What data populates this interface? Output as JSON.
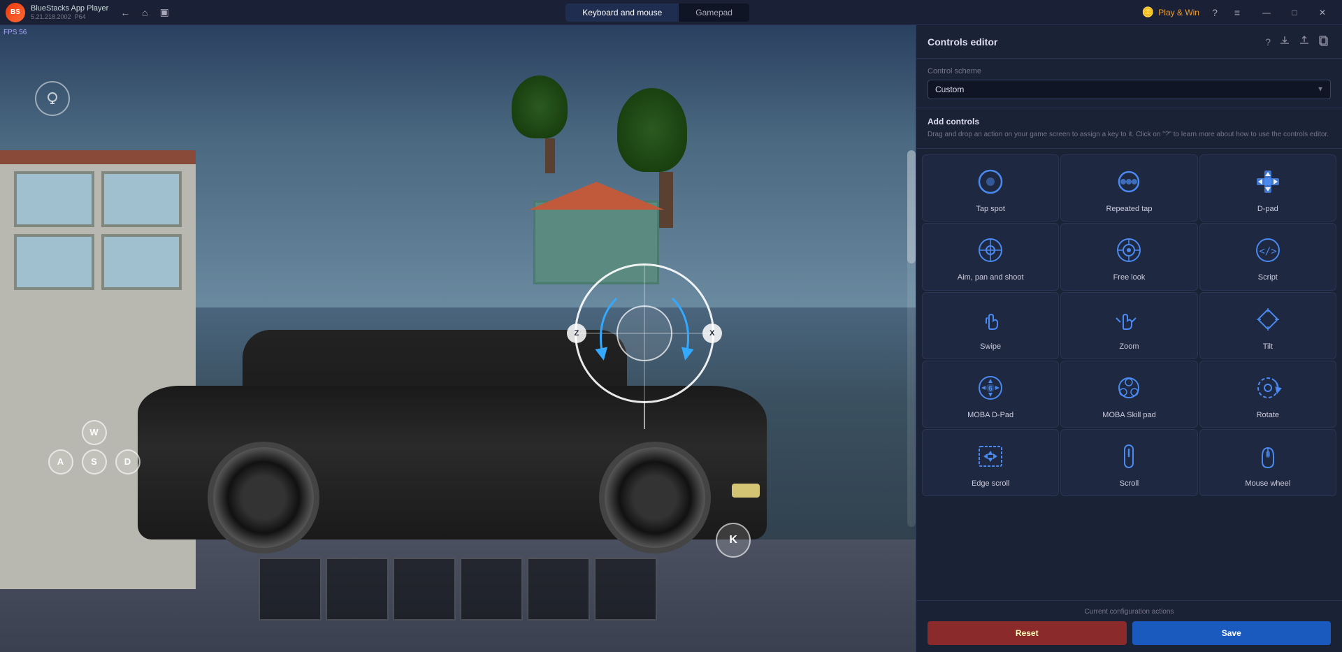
{
  "app": {
    "name": "BlueStacks App Player",
    "version": "5.21.218.2002",
    "arch": "P64",
    "fps": "FPS 56"
  },
  "topbar": {
    "tabs": [
      {
        "id": "keyboard",
        "label": "Keyboard and mouse",
        "active": true
      },
      {
        "id": "gamepad",
        "label": "Gamepad",
        "active": false
      }
    ],
    "play_win_label": "Play & Win",
    "back_icon": "←",
    "home_icon": "⌂",
    "history_icon": "▣",
    "help_icon": "?",
    "menu_icon": "≡",
    "minimize_icon": "—",
    "maximize_icon": "□",
    "close_icon": "✕"
  },
  "panel": {
    "title": "Controls editor",
    "help_icon": "?",
    "scheme_label": "Control scheme",
    "scheme_value": "Custom",
    "add_controls_title": "Add controls",
    "add_controls_desc": "Drag and drop an action on your game screen to assign a key to it. Click on \"?\" to learn more about how to use the controls editor.",
    "controls": [
      {
        "id": "tap_spot",
        "label": "Tap spot",
        "icon_type": "circle"
      },
      {
        "id": "repeated_tap",
        "label": "Repeated tap",
        "icon_type": "circle_dots"
      },
      {
        "id": "d_pad",
        "label": "D-pad",
        "icon_type": "dpad"
      },
      {
        "id": "aim_pan",
        "label": "Aim, pan and shoot",
        "icon_type": "crosshair"
      },
      {
        "id": "free_look",
        "label": "Free look",
        "icon_type": "eye_circle"
      },
      {
        "id": "script",
        "label": "Script",
        "icon_type": "code"
      },
      {
        "id": "swipe",
        "label": "Swipe",
        "icon_type": "hand"
      },
      {
        "id": "zoom",
        "label": "Zoom",
        "icon_type": "hand_zoom"
      },
      {
        "id": "tilt",
        "label": "Tilt",
        "icon_type": "diamond"
      },
      {
        "id": "moba_dpad",
        "label": "MOBA D-Pad",
        "icon_type": "moba_pad"
      },
      {
        "id": "moba_skill",
        "label": "MOBA Skill pad",
        "icon_type": "moba_skill"
      },
      {
        "id": "rotate",
        "label": "Rotate",
        "icon_type": "rotate"
      },
      {
        "id": "edge_scroll",
        "label": "Edge scroll",
        "icon_type": "edge_scroll"
      },
      {
        "id": "scroll",
        "label": "Scroll",
        "icon_type": "scroll"
      },
      {
        "id": "mouse_wheel",
        "label": "Mouse wheel",
        "icon_type": "mouse"
      }
    ],
    "footer": {
      "config_label": "Current configuration actions",
      "reset_label": "Reset",
      "save_label": "Save"
    }
  },
  "game": {
    "keys": {
      "w": "W",
      "a": "A",
      "s": "S",
      "d": "D",
      "k": "K",
      "z": "Z",
      "x": "X"
    }
  }
}
